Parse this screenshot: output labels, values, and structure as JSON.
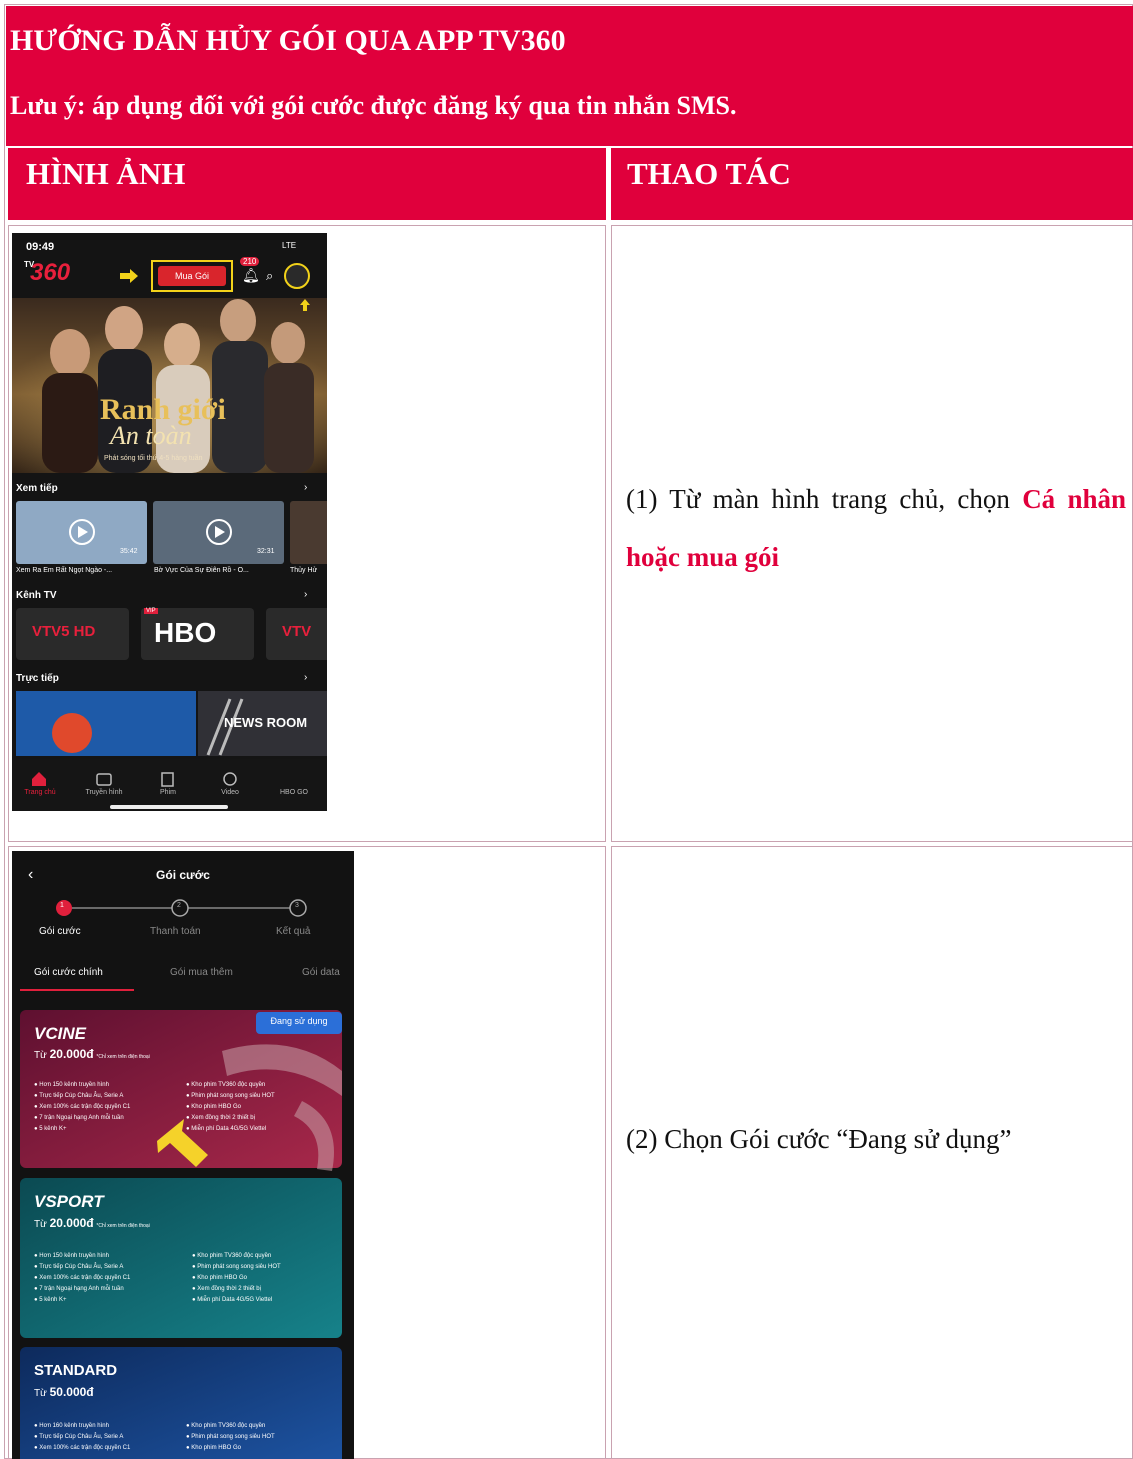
{
  "header": {
    "title": "HƯỚNG DẪN HỦY GÓI QUA APP TV360",
    "note": "Lưu ý: áp dụng đối với gói cước được đăng ký qua tin nhắn SMS."
  },
  "columns": {
    "image": "HÌNH ẢNH",
    "action": "THAO TÁC"
  },
  "steps": [
    {
      "prefix": "(1) Từ màn hình trang chủ, chọn ",
      "highlight": "Cá nhân hoặc mua gói"
    },
    {
      "text": "(2) Chọn Gói cước “Đang sử dụng”"
    }
  ],
  "phone1": {
    "time": "09:49",
    "signal": "LTE",
    "logo": "360",
    "logo_prefix": "TV",
    "buy_button": "Mua Gói",
    "notif_count": "210",
    "hero_title_1": "Ranh giới",
    "hero_title_2": "An toàn",
    "hero_caption": "Phát sóng tối thứ 4-5 hàng tuần",
    "sections": {
      "continue": "Xem tiếp",
      "tv": "Kênh TV",
      "live": "Trực tiếp"
    },
    "continue_items": [
      {
        "title": "Xem Ra Em Rất Ngọt Ngào -...",
        "duration": "35:42"
      },
      {
        "title": "Bờ Vực Của Sự Điên Rồ - O...",
        "duration": "32:31"
      },
      {
        "title": "Thủy Hử",
        "duration": ""
      }
    ],
    "channels": [
      "VTV5 HD",
      "HBO",
      "VTV"
    ],
    "channel_badge": "VIP",
    "live_banner": "NEWS ROOM",
    "nav": [
      "Trang chủ",
      "Truyền hình",
      "Phim",
      "Video",
      "HBO GO"
    ]
  },
  "phone2": {
    "title": "Gói cước",
    "steps": [
      "Gói cước",
      "Thanh toán",
      "Kết quả"
    ],
    "step_numbers": [
      "1",
      "2",
      "3"
    ],
    "tabs": [
      "Gói cước chính",
      "Gói mua thêm",
      "Gói data"
    ],
    "badge": "Đang sử dụng",
    "packages": [
      {
        "name": "CINE",
        "price_prefix": "Từ",
        "price": "20.000đ",
        "price_note": "*Chỉ xem trên điện thoại",
        "features_left": [
          "Hơn 150 kênh truyền hình",
          "Trực tiếp Cúp Châu Âu, Serie A",
          "Xem 100% các trận độc quyền C1",
          "7 trận Ngoại hạng Anh mỗi tuần",
          "5 kênh K+"
        ],
        "features_right": [
          "Kho phim TV360 độc quyền",
          "Phim phát song song siêu HOT",
          "Kho phim HBO Go",
          "Xem đồng thời 2 thiết bị",
          "Miễn phí Data 4G/5G Viettel"
        ],
        "color": "#8a1a3c"
      },
      {
        "name": "SPORT",
        "price_prefix": "Từ",
        "price": "20.000đ",
        "price_note": "*Chỉ xem trên điện thoại",
        "features_left": [
          "Hơn 150 kênh truyền hình",
          "Trực tiếp Cúp Châu Âu, Serie A",
          "Xem 100% các trận độc quyền C1",
          "7 trận Ngoại hạng Anh mỗi tuần",
          "5 kênh K+"
        ],
        "features_right": [
          "Kho phim TV360 độc quyền",
          "Phim phát song song siêu HOT",
          "Kho phim HBO Go",
          "Xem đồng thời 2 thiết bị",
          "Miễn phí Data 4G/5G Viettel"
        ],
        "color": "#0b5e66"
      },
      {
        "name": "STANDARD",
        "price_prefix": "Từ",
        "price": "50.000đ",
        "price_note": "",
        "features_left": [
          "Hơn 160 kênh truyền hình",
          "Trực tiếp Cúp Châu Âu, Serie A",
          "Xem 100% các trận độc quyền C1"
        ],
        "features_right": [
          "Kho phim TV360 độc quyền",
          "Phim phát song song siêu HOT",
          "Kho phim HBO Go"
        ],
        "color": "#123a78"
      }
    ]
  }
}
